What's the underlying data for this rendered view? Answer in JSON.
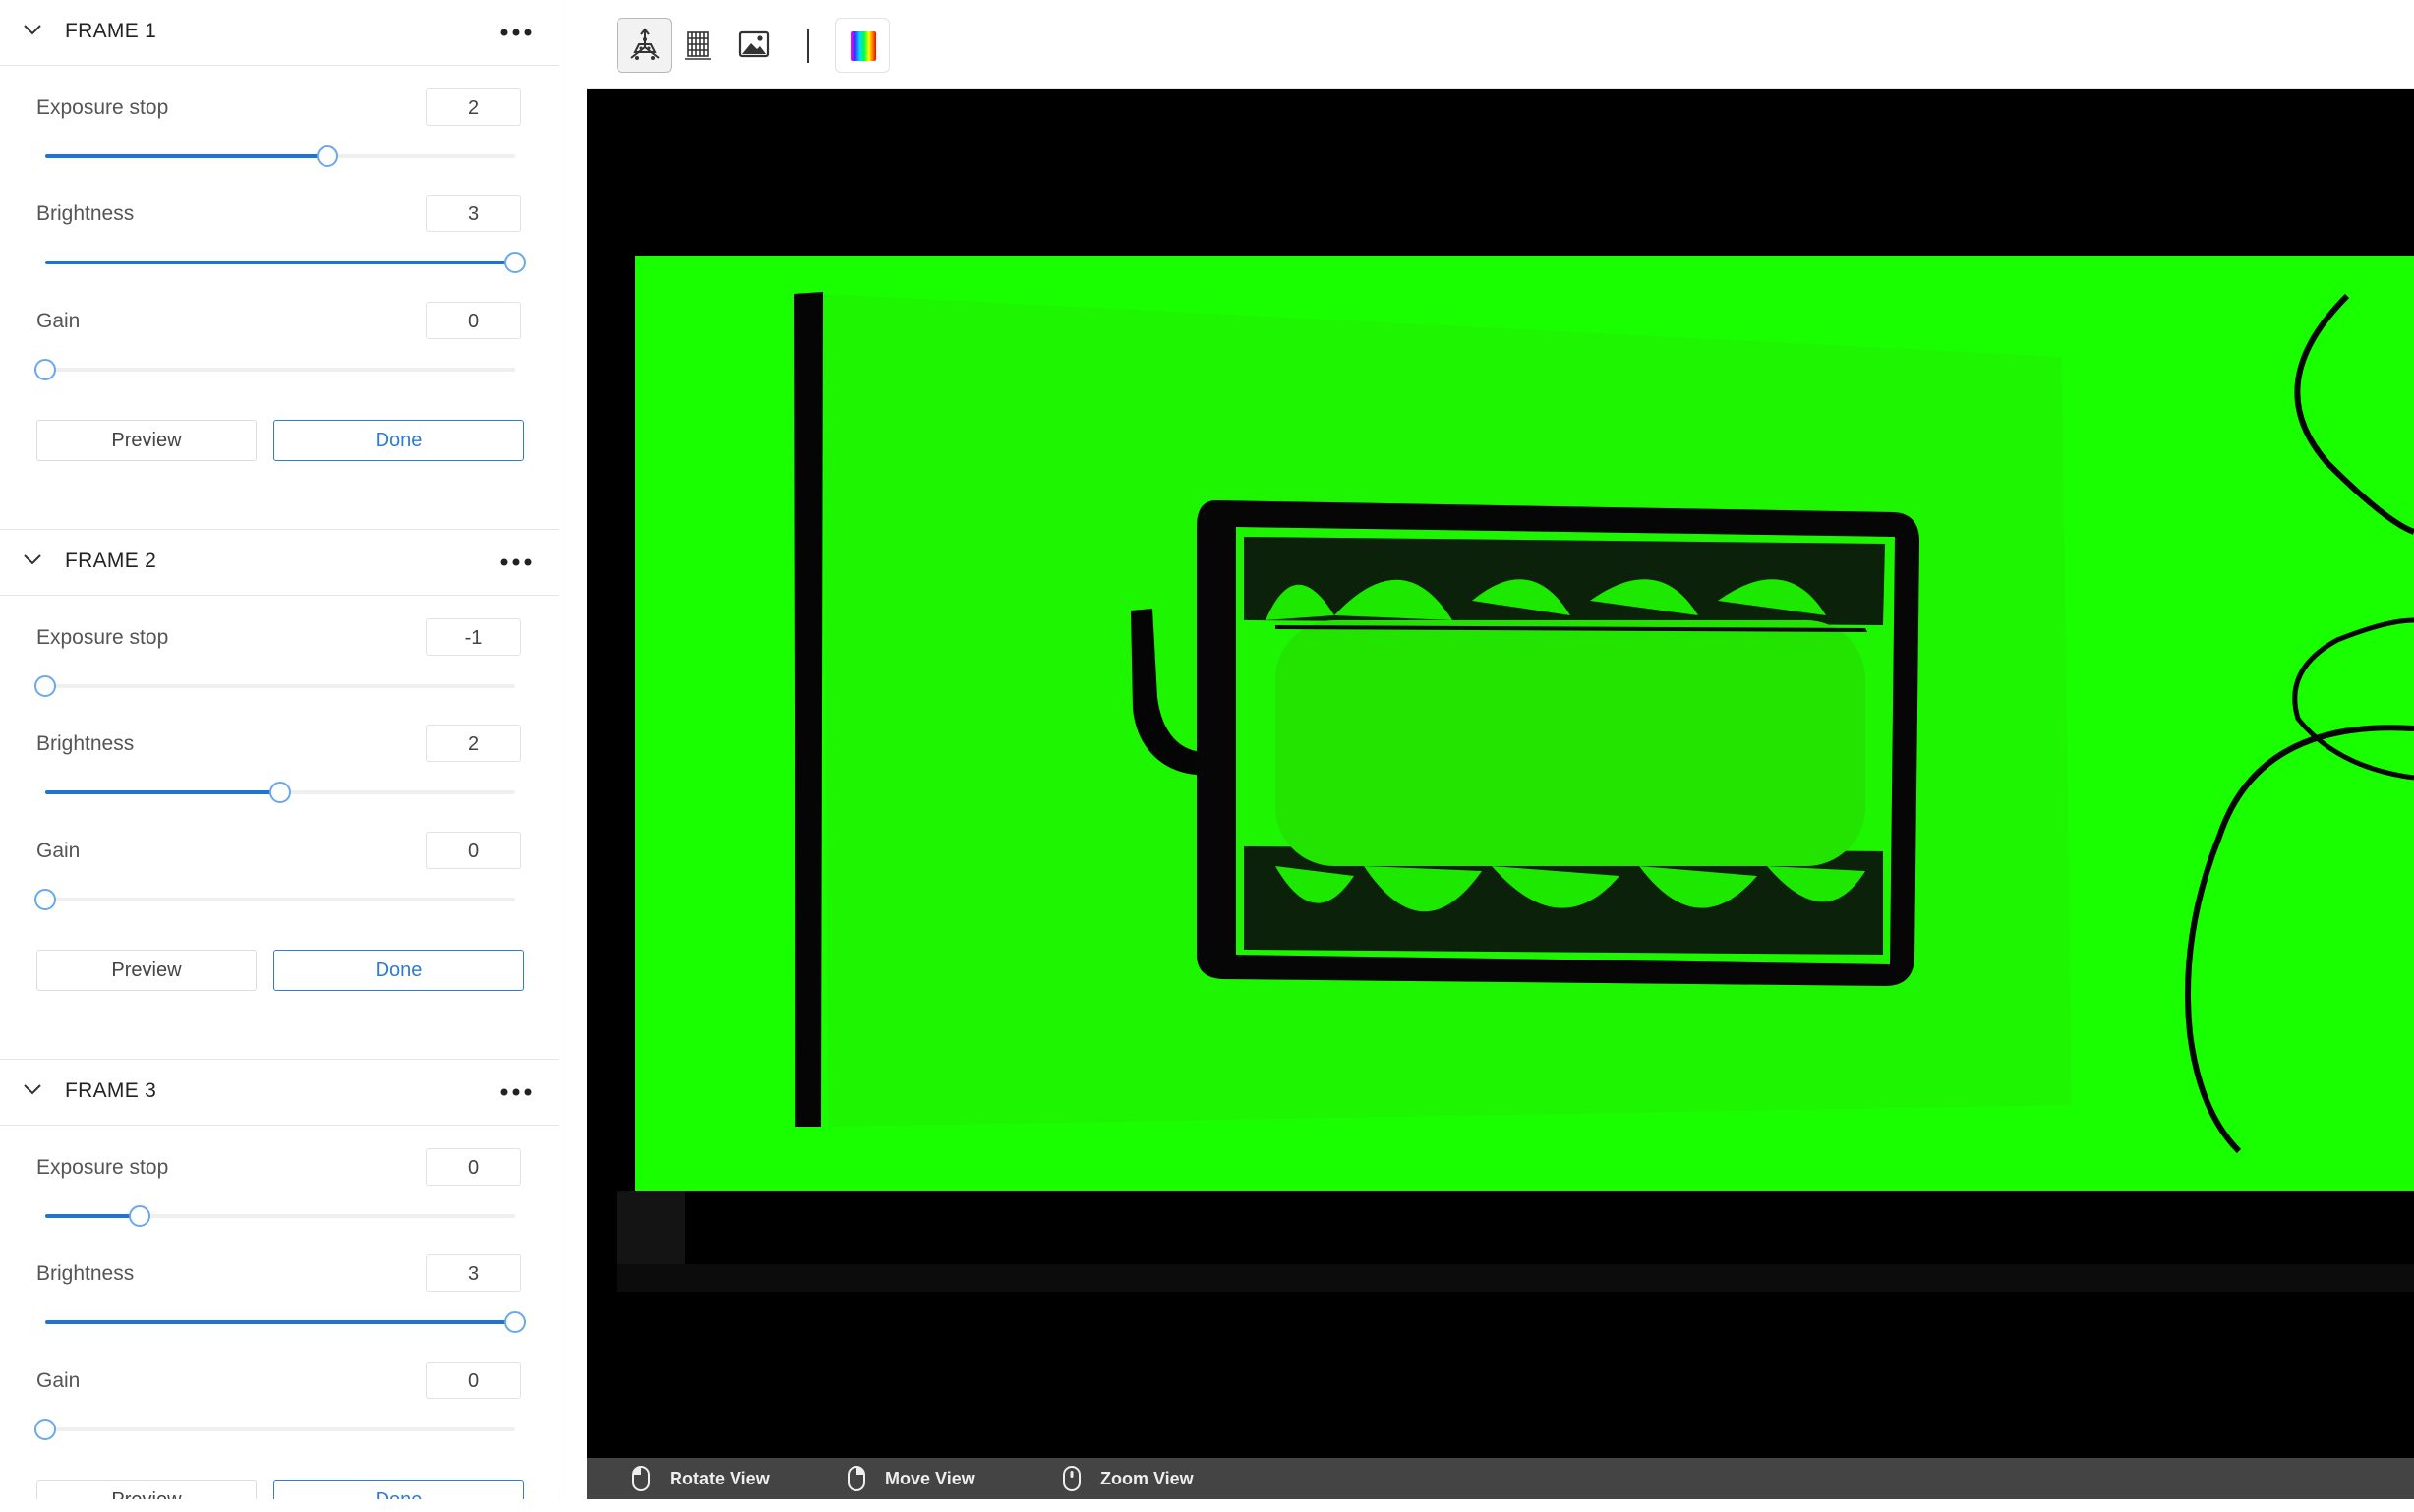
{
  "frames": [
    {
      "title": "FRAME 1",
      "params": [
        {
          "label": "Exposure stop",
          "value": "2",
          "level": 0.6
        },
        {
          "label": "Brightness",
          "value": "3",
          "level": 1.0
        },
        {
          "label": "Gain",
          "value": "0",
          "level": 0.0
        }
      ],
      "preview_label": "Preview",
      "done_label": "Done"
    },
    {
      "title": "FRAME 2",
      "params": [
        {
          "label": "Exposure stop",
          "value": "-1",
          "level": 0.0
        },
        {
          "label": "Brightness",
          "value": "2",
          "level": 0.5
        },
        {
          "label": "Gain",
          "value": "0",
          "level": 0.0
        }
      ],
      "preview_label": "Preview",
      "done_label": "Done"
    },
    {
      "title": "FRAME 3",
      "params": [
        {
          "label": "Exposure stop",
          "value": "0",
          "level": 0.2
        },
        {
          "label": "Brightness",
          "value": "3",
          "level": 1.0
        },
        {
          "label": "Gain",
          "value": "0",
          "level": 0.0
        }
      ],
      "preview_label": "Preview",
      "done_label": "Done"
    }
  ],
  "toolbar": {
    "tools": [
      {
        "icon": "point-cloud-3d-icon",
        "active": true
      },
      {
        "icon": "depth-map-icon",
        "active": false
      },
      {
        "icon": "image-icon",
        "active": false
      },
      {
        "icon": "color-spectrum-icon",
        "active": false
      }
    ]
  },
  "status_bar": {
    "items": [
      {
        "icon": "mouse-left-icon",
        "label": "Rotate View"
      },
      {
        "icon": "mouse-right-icon",
        "label": "Move View"
      },
      {
        "icon": "mouse-wheel-icon",
        "label": "Zoom View"
      }
    ]
  },
  "colors": {
    "accent": "#1e74d6",
    "point_cloud": "#19ff00",
    "viewer_bg": "#000000",
    "status_bar_bg": "#444444"
  }
}
